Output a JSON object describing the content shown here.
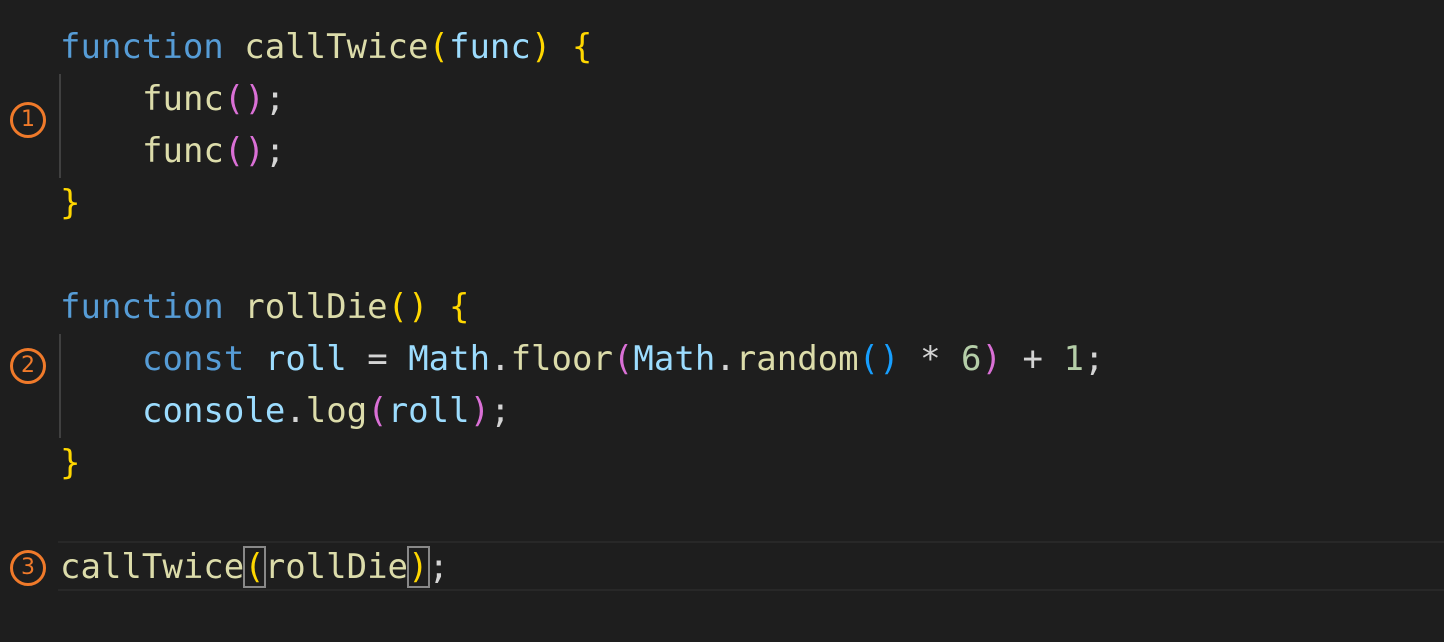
{
  "code": {
    "l1": {
      "kw": "function",
      "name": "callTwice",
      "open": "(",
      "param": "func",
      "close": ")",
      "brace": "{"
    },
    "l2": {
      "call": "func",
      "open": "(",
      "close": ")",
      "semi": ";"
    },
    "l3": {
      "call": "func",
      "open": "(",
      "close": ")",
      "semi": ";"
    },
    "l4": {
      "brace": "}"
    },
    "l6": {
      "kw": "function",
      "name": "rollDie",
      "open": "(",
      "close": ")",
      "brace": "{"
    },
    "l7": {
      "kw": "const",
      "var": "roll",
      "eq": "=",
      "obj1": "Math",
      "dot1": ".",
      "m1": "floor",
      "p1o": "(",
      "obj2": "Math",
      "dot2": ".",
      "m2": "random",
      "p2o": "(",
      "p2c": ")",
      "star": "*",
      "six": "6",
      "p1c": ")",
      "plus": "+",
      "one": "1",
      "semi": ";"
    },
    "l8": {
      "obj": "console",
      "dot": ".",
      "m": "log",
      "open": "(",
      "arg": "roll",
      "close": ")",
      "semi": ";"
    },
    "l9": {
      "brace": "}"
    },
    "l11": {
      "call": "callTwice",
      "open": "(",
      "arg": "rollDie",
      "close": ")",
      "semi": ";"
    }
  },
  "markers": [
    "1",
    "2",
    "3"
  ],
  "colors": {
    "background": "#1e1e1e",
    "keyword": "#569cd6",
    "function": "#dcdcaa",
    "variable": "#9cdcfe",
    "number": "#b5cea8",
    "bracket_level1": "#ffd700",
    "bracket_level2": "#da70d6",
    "bracket_level3": "#179fff",
    "marker": "#f07a2a"
  }
}
